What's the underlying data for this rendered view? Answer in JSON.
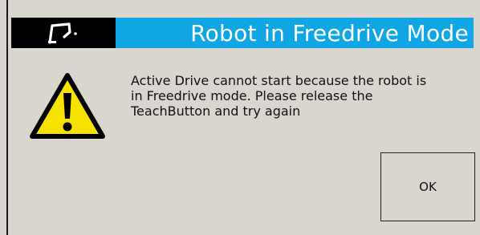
{
  "window": {
    "title": "Robot in Freedrive Mode",
    "logo_icon": "robot-arm-logo-icon",
    "title_bar_color": "#10a6e4",
    "logo_bg_color": "#000000"
  },
  "dialog": {
    "icon": "warning-icon",
    "message": "Active Drive cannot start because the robot is in Freedrive mode. Please release the TeachButton and try again",
    "ok_label": "OK"
  }
}
